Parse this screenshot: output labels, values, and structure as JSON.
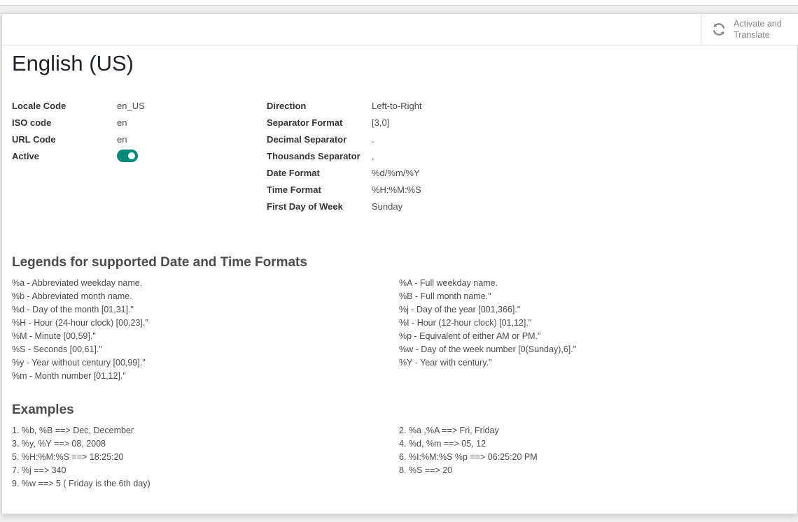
{
  "header_button": {
    "line1": "Activate and",
    "line2": "Translate",
    "icon": "refresh-icon"
  },
  "title": "English (US)",
  "left_fields": [
    {
      "label": "Locale Code",
      "value": "en_US"
    },
    {
      "label": "ISO code",
      "value": "en"
    },
    {
      "label": "URL Code",
      "value": "en"
    },
    {
      "label": "Active",
      "value": ""
    }
  ],
  "active_toggle": {
    "checked": true,
    "color": "#01897b"
  },
  "right_fields": [
    {
      "label": "Direction",
      "value": "Left-to-Right"
    },
    {
      "label": "Separator Format",
      "value": "[3,0]"
    },
    {
      "label": "Decimal Separator",
      "value": "."
    },
    {
      "label": "Thousands Separator",
      "value": ","
    },
    {
      "label": "Date Format",
      "value": "%d/%m/%Y"
    },
    {
      "label": "Time Format",
      "value": "%H:%M:%S"
    },
    {
      "label": "First Day of Week",
      "value": "Sunday"
    }
  ],
  "legend": {
    "title": "Legends for supported Date and Time Formats",
    "left": [
      "%a - Abbreviated weekday name.",
      "%b - Abbreviated month name.",
      "%d - Day of the month [01,31].\"",
      "%H - Hour (24-hour clock) [00,23].\"",
      "%M - Minute [00,59].\"",
      "%S - Seconds [00,61].\"",
      "%y - Year without century [00,99].\"",
      "%m - Month number [01,12].\""
    ],
    "right": [
      "%A - Full weekday name.",
      "%B - Full month name.\"",
      "%j - Day of the year [001,366].\"",
      "%I - Hour (12-hour clock) [01,12].\"",
      "%p - Equivalent of either AM or PM.\"",
      "%w - Day of the week number [0(Sunday),6].\"",
      "%Y - Year with century.\""
    ]
  },
  "examples": {
    "title": "Examples",
    "left": [
      "1. %b, %B ==> Dec, December",
      "3. %y, %Y ==> 08, 2008",
      "5. %H:%M:%S ==> 18:25:20",
      "7. %j ==> 340",
      "9. %w ==> 5 ( Friday is the 6th day)"
    ],
    "right": [
      "2. %a ,%A ==> Fri, Friday",
      "4. %d, %m ==> 05, 12",
      "6. %I:%M:%S %p ==> 06:25:20 PM",
      "8. %S ==> 20"
    ]
  }
}
